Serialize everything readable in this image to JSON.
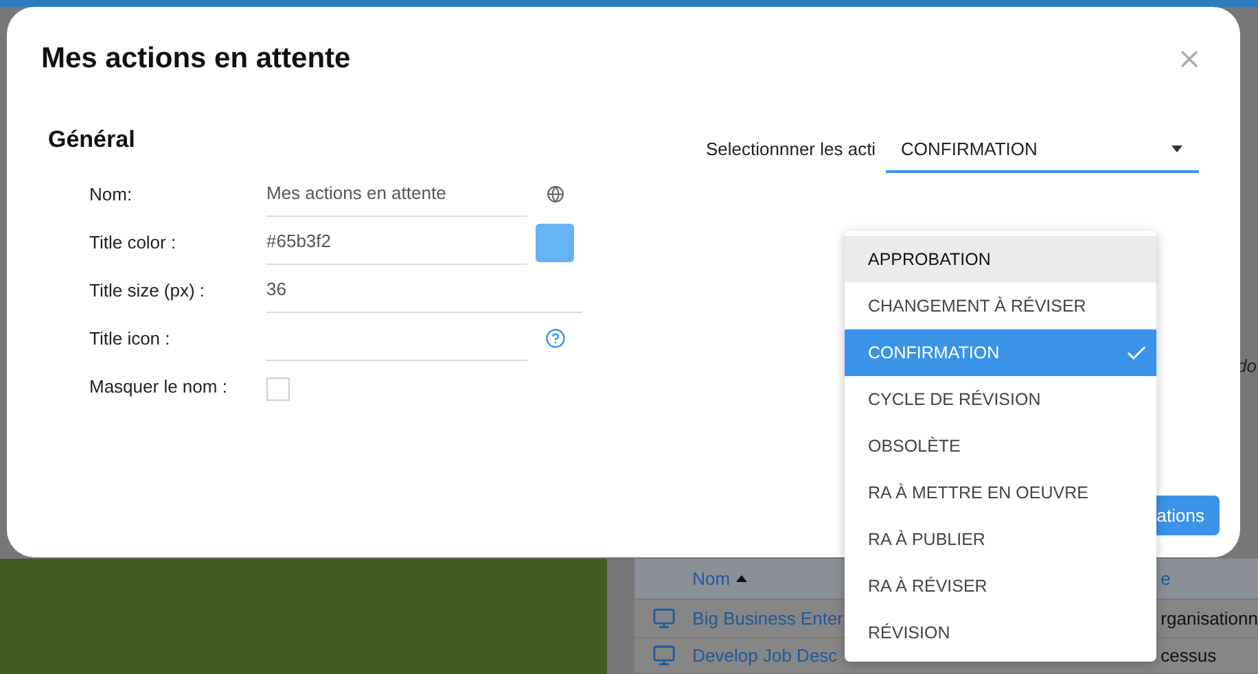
{
  "background": {
    "side_text": "do",
    "table": {
      "columns": [
        {
          "label": "Nom",
          "sorted": true
        },
        {
          "label": "e",
          "sorted": false
        }
      ],
      "rows": [
        {
          "name": "Big Business Enter",
          "type": "rganisationn"
        },
        {
          "name": "Develop Job Desc",
          "type": "cessus"
        }
      ]
    }
  },
  "dialog": {
    "title": "Mes actions en attente",
    "section": "Général",
    "fields": [
      {
        "kind": "translatable",
        "label": "Nom:",
        "value": "Mes actions en attente"
      },
      {
        "kind": "color",
        "label": "Title color :",
        "value": "#65b3f2"
      },
      {
        "kind": "text",
        "label": "Title size (px) :",
        "value": "36"
      },
      {
        "kind": "icon",
        "label": "Title icon :"
      },
      {
        "kind": "checkbox",
        "label": "Masquer le nom :",
        "checked": false
      }
    ],
    "select": {
      "label": "Selectionnner les acti",
      "value": "CONFIRMATION",
      "expanded": true,
      "options": [
        {
          "label": "APPROBATION",
          "selected": false,
          "highlighted": true
        },
        {
          "label": "CHANGEMENT À RÉVISER",
          "selected": false,
          "highlighted": false
        },
        {
          "label": "CONFIRMATION",
          "selected": true,
          "highlighted": false
        },
        {
          "label": "CYCLE DE RÉVISION",
          "selected": false,
          "highlighted": false
        },
        {
          "label": "OBSOLÈTE",
          "selected": false,
          "highlighted": false
        },
        {
          "label": "RA À METTRE EN OEUVRE",
          "selected": false,
          "highlighted": false
        },
        {
          "label": "RA À PUBLIER",
          "selected": false,
          "highlighted": false
        },
        {
          "label": "RA À RÉVISER",
          "selected": false,
          "highlighted": false
        },
        {
          "label": "RÉVISION",
          "selected": false,
          "highlighted": false
        }
      ]
    },
    "button": "ations"
  }
}
